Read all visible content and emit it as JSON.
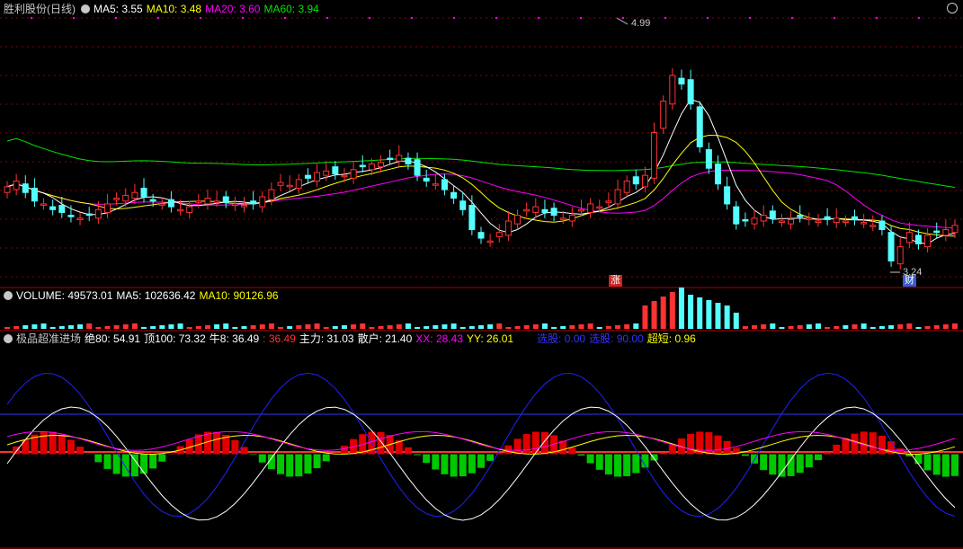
{
  "header": {
    "stock_name": "胜利股份(日线)",
    "ma5": "MA5: 3.55",
    "ma10": "MA10: 3.48",
    "ma20": "MA20: 3.60",
    "ma60": "MA60: 3.94"
  },
  "volume_header": {
    "volume": "VOLUME: 49573.01",
    "ma5": "MA5: 102636.42",
    "ma10": "MA10: 90126.96"
  },
  "indicator_header": {
    "name": "极品超准进场",
    "jue80": "绝80: 54.91",
    "ding100": "顶100: 73.32",
    "niu8": "牛8: 36.49",
    "v4": ": 36.49",
    "zhuli": "主力: 31.03",
    "sanhu": "散户: 21.40",
    "xx": "XX: 28.43",
    "yy": "YY: 26.01",
    "xuangu1": "选股: 0.00",
    "xuangu2": "选股: 90.00",
    "chaoduan": "超短: 0.96"
  },
  "annotations": {
    "high": "4.99",
    "low": "3.24",
    "zhang": "涨",
    "cai": "财"
  },
  "colors": {
    "up": "#ff3232",
    "down": "#54ffff",
    "ma5": "#ffffff",
    "ma10": "#ffff00",
    "ma20": "#ff00ff",
    "ma60": "#00e600",
    "grid": "#8b0000",
    "header_name": "#c8c8c8"
  },
  "chart_data": {
    "type": "candlestick",
    "y_range": [
      3.24,
      4.99
    ],
    "closes": [
      3.82,
      3.86,
      3.78,
      3.72,
      3.7,
      3.66,
      3.64,
      3.61,
      3.6,
      3.62,
      3.66,
      3.7,
      3.74,
      3.76,
      3.78,
      3.75,
      3.72,
      3.7,
      3.68,
      3.66,
      3.68,
      3.72,
      3.74,
      3.72,
      3.71,
      3.7,
      3.69,
      3.7,
      3.75,
      3.8,
      3.85,
      3.83,
      3.87,
      3.88,
      3.92,
      3.93,
      3.91,
      3.9,
      3.94,
      3.96,
      3.98,
      3.99,
      4.02,
      4.04,
      3.98,
      3.9,
      3.86,
      3.84,
      3.8,
      3.74,
      3.66,
      3.52,
      3.46,
      3.44,
      3.5,
      3.58,
      3.62,
      3.66,
      3.68,
      3.64,
      3.62,
      3.6,
      3.62,
      3.66,
      3.7,
      3.68,
      3.72,
      3.8,
      3.86,
      3.84,
      3.9,
      4.2,
      4.42,
      4.6,
      4.54,
      4.4,
      4.1,
      3.95,
      3.84,
      3.7,
      3.56,
      3.58,
      3.6,
      3.62,
      3.6,
      3.58,
      3.59,
      3.61,
      3.6,
      3.58,
      3.59,
      3.6,
      3.58,
      3.59,
      3.57,
      3.55,
      3.52,
      3.3,
      3.4,
      3.5,
      3.42,
      3.48,
      3.5,
      3.52,
      3.55
    ]
  }
}
